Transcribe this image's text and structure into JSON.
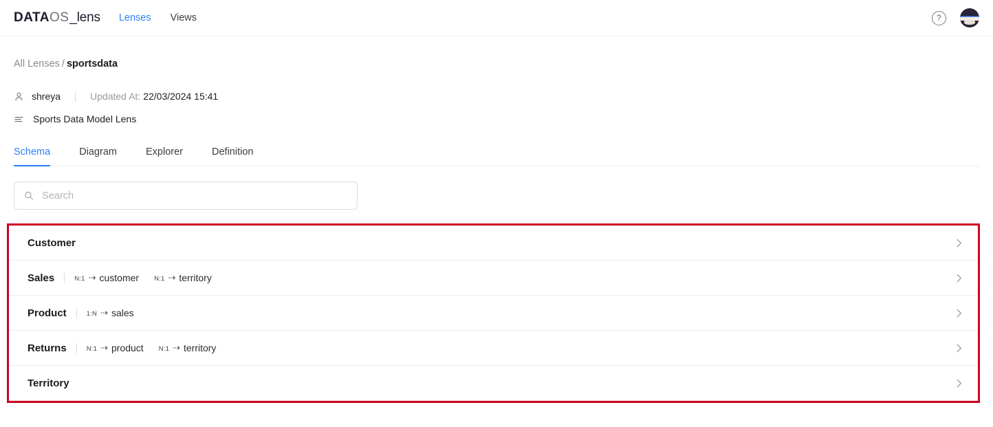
{
  "topbar": {
    "logo": {
      "data": "DATA",
      "os": "OS",
      "lens": "_lens"
    },
    "nav": [
      {
        "label": "Lenses",
        "active": true
      },
      {
        "label": "Views",
        "active": false
      }
    ],
    "help_icon": "question-mark-icon",
    "help_glyph": "?",
    "avatar": "user-avatar"
  },
  "breadcrumb": {
    "root": "All Lenses",
    "separator": "/",
    "current": "sportsdata"
  },
  "meta": {
    "user_icon": "person-icon",
    "user": "shreya",
    "updated_label": "Updated At:",
    "updated_value": "22/03/2024 15:41",
    "description_icon": "lines-icon",
    "description": "Sports Data Model Lens"
  },
  "tabs": [
    {
      "label": "Schema",
      "active": true
    },
    {
      "label": "Diagram",
      "active": false
    },
    {
      "label": "Explorer",
      "active": false
    },
    {
      "label": "Definition",
      "active": false
    }
  ],
  "search": {
    "icon": "search-icon",
    "placeholder": "Search",
    "value": ""
  },
  "entities": [
    {
      "name": "Customer",
      "relations": []
    },
    {
      "name": "Sales",
      "relations": [
        {
          "cardinality": "N:1",
          "arrow": "⇢",
          "target": "customer"
        },
        {
          "cardinality": "N:1",
          "arrow": "⇢",
          "target": "territory"
        }
      ]
    },
    {
      "name": "Product",
      "relations": [
        {
          "cardinality": "1:N",
          "arrow": "⇢",
          "target": "sales"
        }
      ]
    },
    {
      "name": "Returns",
      "relations": [
        {
          "cardinality": "N:1",
          "arrow": "⇢",
          "target": "product"
        },
        {
          "cardinality": "N:1",
          "arrow": "⇢",
          "target": "territory"
        }
      ]
    },
    {
      "name": "Territory",
      "relations": []
    }
  ],
  "colors": {
    "accent_blue": "#2a7fff",
    "highlight_red": "#cc0022",
    "text_primary": "#1a1a1a",
    "text_muted": "#8a8a8a",
    "border": "#ececec"
  }
}
